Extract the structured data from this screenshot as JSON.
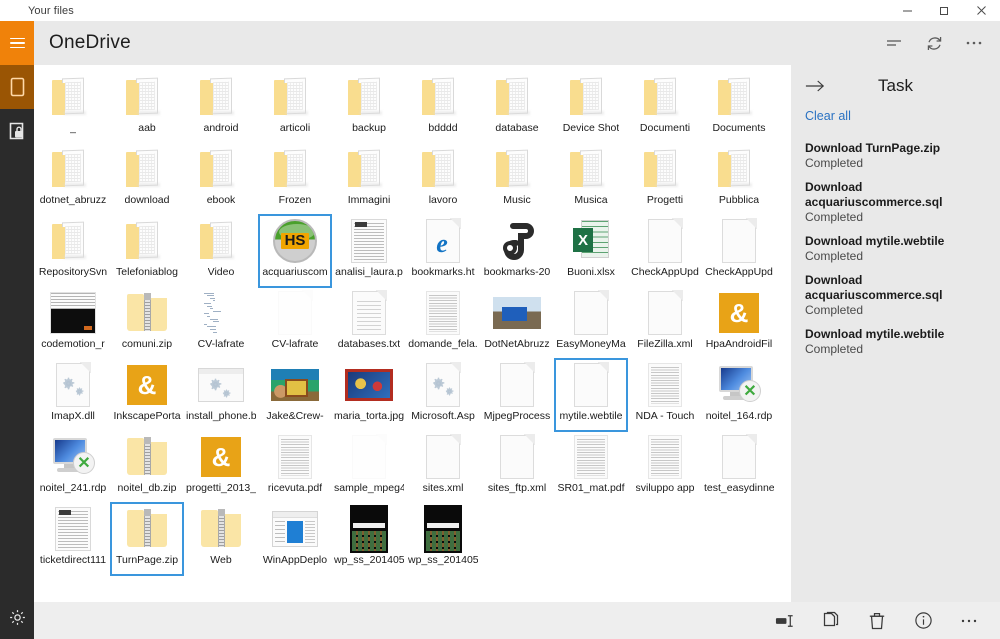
{
  "window": {
    "title": "Your files",
    "buttons": [
      {
        "name": "minimize",
        "glyph": "minimize-icon"
      },
      {
        "name": "maximize",
        "glyph": "maximize-icon"
      },
      {
        "name": "close",
        "glyph": "close-icon"
      }
    ]
  },
  "rail": {
    "items": [
      {
        "name": "hamburger-menu",
        "icon": "hamburger-icon"
      },
      {
        "name": "files",
        "icon": "file-page-icon"
      },
      {
        "name": "vault",
        "icon": "lock-folder-icon"
      },
      {
        "name": "settings",
        "icon": "gear-icon"
      }
    ]
  },
  "header": {
    "title": "OneDrive",
    "actions": [
      {
        "name": "sort",
        "icon": "sort-icon"
      },
      {
        "name": "refresh",
        "icon": "refresh-icon"
      },
      {
        "name": "more",
        "icon": "ellipsis-icon"
      }
    ]
  },
  "task": {
    "title": "Task",
    "back_icon": "arrow-right-icon",
    "clear_all": "Clear all",
    "items": [
      {
        "name": "Download TurnPage.zip",
        "status": "Completed"
      },
      {
        "name": "Download acquariuscommerce.sql",
        "status": "Completed"
      },
      {
        "name": "Download mytile.webtile",
        "status": "Completed"
      },
      {
        "name": "Download acquariuscommerce.sql",
        "status": "Completed"
      },
      {
        "name": "Download mytile.webtile",
        "status": "Completed"
      }
    ]
  },
  "bottombar": {
    "actions": [
      {
        "name": "rename",
        "icon": "rename-icon",
        "label": "Rename"
      },
      {
        "name": "copy",
        "icon": "copy-icon",
        "label": "Copy"
      },
      {
        "name": "delete",
        "icon": "trash-icon",
        "label": "Delete"
      },
      {
        "name": "info",
        "icon": "info-icon",
        "label": "Info"
      },
      {
        "name": "more",
        "icon": "ellipsis-icon",
        "label": "More"
      }
    ]
  },
  "colors": {
    "accent_orange": "#f0820a",
    "rail_dark": "#2b2b2b",
    "rail_selected": "#9a5504",
    "header_gray": "#e9e9e9",
    "selection_blue": "#3a96dd",
    "link_blue": "#2a72c2",
    "amber_tile": "#e8a317"
  },
  "files": [
    {
      "label": "_",
      "icon": "folder",
      "selected": false
    },
    {
      "label": "aab",
      "icon": "folder",
      "selected": false
    },
    {
      "label": "android",
      "icon": "folder",
      "selected": false
    },
    {
      "label": "articoli",
      "icon": "folder",
      "selected": false
    },
    {
      "label": "backup",
      "icon": "folder",
      "selected": false
    },
    {
      "label": "bdddd",
      "icon": "folder",
      "selected": false
    },
    {
      "label": "database",
      "icon": "folder",
      "selected": false
    },
    {
      "label": "Device Shot",
      "icon": "folder",
      "selected": false
    },
    {
      "label": "Documenti",
      "icon": "folder",
      "selected": false
    },
    {
      "label": "Documents",
      "icon": "folder",
      "selected": false
    },
    {
      "label": "dotnet_abruzz",
      "icon": "folder",
      "selected": false
    },
    {
      "label": "download",
      "icon": "folder",
      "selected": false
    },
    {
      "label": "ebook",
      "icon": "folder",
      "selected": false
    },
    {
      "label": "Frozen",
      "icon": "folder",
      "selected": false
    },
    {
      "label": "Immagini",
      "icon": "folder",
      "selected": false
    },
    {
      "label": "lavoro",
      "icon": "folder",
      "selected": false
    },
    {
      "label": "Music",
      "icon": "folder",
      "selected": false
    },
    {
      "label": "Musica",
      "icon": "folder",
      "selected": false
    },
    {
      "label": "Progetti",
      "icon": "folder",
      "selected": false
    },
    {
      "label": "Pubblica",
      "icon": "folder",
      "selected": false
    },
    {
      "label": "RepositorySvn",
      "icon": "folder",
      "selected": false
    },
    {
      "label": "Telefoniablog",
      "icon": "folder",
      "selected": false
    },
    {
      "label": "Video",
      "icon": "folder",
      "selected": false
    },
    {
      "label": "acquariuscom",
      "icon": "hs-logo",
      "selected": true
    },
    {
      "label": "analisi_laura.p",
      "icon": "scan-doc",
      "selected": false
    },
    {
      "label": "bookmarks.ht",
      "icon": "edge-doc",
      "selected": false
    },
    {
      "label": "bookmarks-20",
      "icon": "blob",
      "selected": false
    },
    {
      "label": "Buoni.xlsx",
      "icon": "excel",
      "selected": false
    },
    {
      "label": "CheckAppUpd",
      "icon": "doc-blank",
      "selected": false
    },
    {
      "label": "CheckAppUpd",
      "icon": "doc-blank",
      "selected": false
    },
    {
      "label": "codemotion_r",
      "icon": "code-shot",
      "selected": false
    },
    {
      "label": "comuni.zip",
      "icon": "zip",
      "selected": false
    },
    {
      "label": "CV-lafrate",
      "icon": "txtcol",
      "selected": false
    },
    {
      "label": "CV-lafrate",
      "icon": "faint",
      "selected": false
    },
    {
      "label": "databases.txt",
      "icon": "doc-lines",
      "selected": false
    },
    {
      "label": "domande_fela.",
      "icon": "doc-text",
      "selected": false
    },
    {
      "label": "DotNetAbruzz",
      "icon": "img-dotnet",
      "selected": false
    },
    {
      "label": "EasyMoneyMa",
      "icon": "doc-blank",
      "selected": false
    },
    {
      "label": "FileZilla.xml",
      "icon": "doc-blank",
      "selected": false
    },
    {
      "label": "HpaAndroidFil",
      "icon": "amber-amp",
      "selected": false
    },
    {
      "label": "ImapX.dll",
      "icon": "doc-gear",
      "selected": false
    },
    {
      "label": "InkscapePorta",
      "icon": "amber-amp",
      "selected": false
    },
    {
      "label": "install_phone.b",
      "icon": "win-gear",
      "selected": false
    },
    {
      "label": "Jake&Crew-",
      "icon": "img-jake",
      "selected": false
    },
    {
      "label": "maria_torta.jpg",
      "icon": "img-maria",
      "selected": false
    },
    {
      "label": "Microsoft.Asp",
      "icon": "doc-gear",
      "selected": false
    },
    {
      "label": "MjpegProcess",
      "icon": "doc-blank",
      "selected": false
    },
    {
      "label": "mytile.webtile",
      "icon": "doc-blank",
      "selected": true
    },
    {
      "label": "NDA - Touch",
      "icon": "doc-text",
      "selected": false
    },
    {
      "label": "noitel_164.rdp",
      "icon": "rdp",
      "selected": false
    },
    {
      "label": "noitel_241.rdp",
      "icon": "rdp",
      "selected": false
    },
    {
      "label": "noitel_db.zip",
      "icon": "zip",
      "selected": false
    },
    {
      "label": "progetti_2013_",
      "icon": "amber-amp",
      "selected": false
    },
    {
      "label": "ricevuta.pdf",
      "icon": "doc-text",
      "selected": false
    },
    {
      "label": "sample_mpeg4",
      "icon": "faint",
      "selected": false
    },
    {
      "label": "sites.xml",
      "icon": "doc-blank",
      "selected": false
    },
    {
      "label": "sites_ftp.xml",
      "icon": "doc-blank",
      "selected": false
    },
    {
      "label": "SR01_mat.pdf",
      "icon": "doc-text",
      "selected": false
    },
    {
      "label": "sviluppo app",
      "icon": "doc-text",
      "selected": false
    },
    {
      "label": "test_easydinne",
      "icon": "doc-blank",
      "selected": false
    },
    {
      "label": "ticketdirect111",
      "icon": "scan-doc",
      "selected": false
    },
    {
      "label": "TurnPage.zip",
      "icon": "zip",
      "selected": true
    },
    {
      "label": "Web",
      "icon": "zip",
      "selected": false
    },
    {
      "label": "WinAppDeplo",
      "icon": "winapp",
      "selected": false
    },
    {
      "label": "wp_ss_201405",
      "icon": "phone",
      "selected": false
    },
    {
      "label": "wp_ss_201405",
      "icon": "phone",
      "selected": false
    }
  ]
}
